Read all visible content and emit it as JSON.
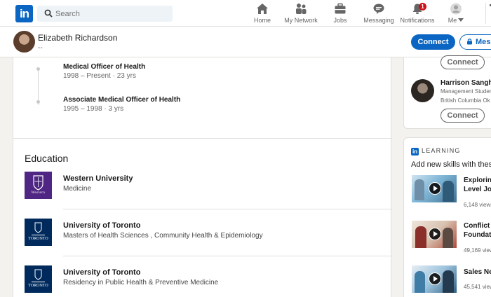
{
  "nav": {
    "search_placeholder": "Search",
    "items": [
      {
        "label": "Home",
        "icon": "home-icon"
      },
      {
        "label": "My Network",
        "icon": "network-icon"
      },
      {
        "label": "Jobs",
        "icon": "briefcase-icon"
      },
      {
        "label": "Messaging",
        "icon": "messaging-icon"
      },
      {
        "label": "Notifications",
        "icon": "bell-icon",
        "badge": "1"
      },
      {
        "label": "Me",
        "icon": "avatar-icon"
      },
      {
        "label": "W",
        "icon": "work-icon"
      }
    ]
  },
  "profile": {
    "name": "Elizabeth Richardson",
    "headline": "--",
    "connect_label": "Connect",
    "message_label": "Message"
  },
  "experience": [
    {
      "title": "Medical Officer of Health",
      "dates": "1998 – Present · 23 yrs"
    },
    {
      "title": "Associate Medical Officer of Health",
      "dates": "1995 – 1998 · 3 yrs"
    }
  ],
  "education": {
    "heading": "Education",
    "items": [
      {
        "school": "Western University",
        "degree": "Medicine",
        "logo_text": "Western",
        "color": "#4f2683"
      },
      {
        "school": "University of Toronto",
        "degree": "Masters of Health Sciences , Community Health & Epidemiology",
        "logo_text": "TORONTO",
        "color": "#002a5c"
      },
      {
        "school": "University of Toronto",
        "degree": "Residency in Public Health & Preventive Medicine",
        "logo_text": "TORONTO",
        "color": "#002a5c"
      }
    ]
  },
  "rail": {
    "people": {
      "connect_top_label": "Connect",
      "person": {
        "name": "Harrison Sanghar",
        "line1": "Management Studen",
        "line2": "British Columbia Ok",
        "connect_label": "Connect"
      }
    },
    "learning": {
      "brand": "LEARNING",
      "subtitle": "Add new skills with these",
      "courses": [
        {
          "title1": "Exploring",
          "title2": "Level Job",
          "views": "6,148 views"
        },
        {
          "title1": "Conflict R",
          "title2": "Foundatio",
          "views": "49,169 views"
        },
        {
          "title1": "Sales Neg",
          "title2": "",
          "views": "45,541 views"
        }
      ]
    }
  },
  "colors": {
    "brand_blue": "#0a66c2",
    "badge_red": "#cc1016",
    "page_bg": "#f3f2ef"
  }
}
